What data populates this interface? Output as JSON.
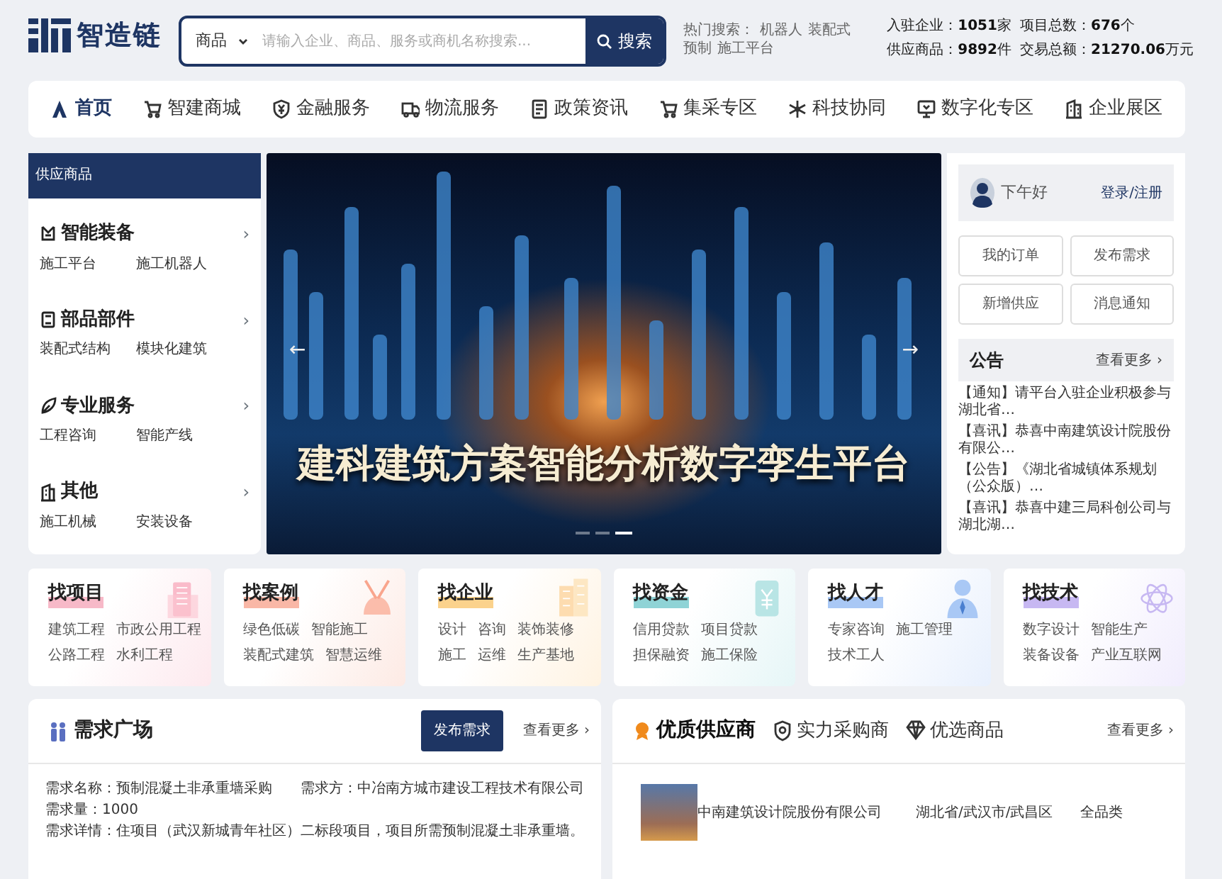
{
  "logo": {
    "text": "智造链"
  },
  "search": {
    "category": "商品",
    "placeholder": "请输入企业、商品、服务或商机名称搜索...",
    "button": "搜索"
  },
  "hot_search": {
    "label": "热门搜索：",
    "terms": [
      "机器人",
      "装配式",
      "预制",
      "施工平台"
    ]
  },
  "stats": [
    {
      "label": "入驻企业：",
      "value": "1051",
      "unit": "家"
    },
    {
      "label": "项目总数：",
      "value": "676",
      "unit": "个"
    },
    {
      "label": "供应商品：",
      "value": "9892",
      "unit": "件"
    },
    {
      "label": "交易总额：",
      "value": "21270.06",
      "unit": "万元"
    }
  ],
  "nav": [
    {
      "label": "首页",
      "selected": true
    },
    {
      "label": "智建商城",
      "selected": false
    },
    {
      "label": "金融服务",
      "selected": false
    },
    {
      "label": "物流服务",
      "selected": false
    },
    {
      "label": "政策资讯",
      "selected": false
    },
    {
      "label": "集采专区",
      "selected": false
    },
    {
      "label": "科技协同",
      "selected": false
    },
    {
      "label": "数字化专区",
      "selected": false
    },
    {
      "label": "企业展区",
      "selected": false
    }
  ],
  "sidebar": {
    "title": "供应商品",
    "categories": [
      {
        "name": "智能装备",
        "arrow": "›",
        "links": [
          "施工平台",
          "施工机器人"
        ]
      },
      {
        "name": "部品部件",
        "arrow": "›",
        "links": [
          "装配式结构",
          "模块化建筑"
        ]
      },
      {
        "name": "专业服务",
        "arrow": "›",
        "links": [
          "工程咨询",
          "智能产线"
        ]
      },
      {
        "name": "其他",
        "arrow": "›",
        "links": [
          "施工机械",
          "安装设备"
        ]
      }
    ]
  },
  "banner": {
    "title": "建科建筑方案智能分析数字孪生平台",
    "prev": "←",
    "next": "→",
    "indicators": [
      {
        "selected": false
      },
      {
        "selected": false
      },
      {
        "selected": true
      }
    ]
  },
  "user_panel": {
    "greeting": "下午好",
    "login": "登录/注册",
    "actions": [
      "我的订单",
      "发布需求",
      "新增供应",
      "消息通知"
    ],
    "notices": {
      "title": "公告",
      "more": "查看更多 ›",
      "items": [
        "【通知】请平台入驻企业积极参与湖北省…",
        "【喜讯】恭喜中南建筑设计院股份有限公…",
        "【公告】《湖北省城镇体系规划（公众版）…",
        "【喜讯】恭喜中建三局科创公司与湖北湖…"
      ]
    }
  },
  "finders": [
    {
      "title": "找项目",
      "links": [
        "建筑工程",
        "市政公用工程",
        "公路工程",
        "水利工程"
      ]
    },
    {
      "title": "找案例",
      "links": [
        "绿色低碳",
        "智能施工",
        "装配式建筑",
        "智慧运维"
      ]
    },
    {
      "title": "找企业",
      "links": [
        "设计",
        "咨询",
        "装饰装修",
        "施工",
        "运维",
        "生产基地"
      ]
    },
    {
      "title": "找资金",
      "links": [
        "信用贷款",
        "项目贷款",
        "担保融资",
        "施工保险"
      ]
    },
    {
      "title": "找人才",
      "links": [
        "专家咨询",
        "施工管理",
        "技术工人"
      ]
    },
    {
      "title": "找技术",
      "links": [
        "数字设计",
        "智能生产",
        "装备设备",
        "产业互联网"
      ]
    }
  ],
  "demand": {
    "title": "需求广场",
    "publish": "发布需求",
    "more": "查看更多 ›",
    "item": {
      "name": "需求名称：预制混凝土非承重墙采购",
      "buyer": "需求方：中冶南方城市建设工程技术有限公司",
      "quantity": "需求量：1000",
      "detail": "需求详情：住项目（武汉新城青年社区）二标段项目，项目所需预制混凝土非承重墙。"
    }
  },
  "suppliers": {
    "tabs": [
      {
        "label": "优质供应商",
        "selected": true
      },
      {
        "label": "实力采购商",
        "selected": false
      },
      {
        "label": "优选商品",
        "selected": false
      }
    ],
    "more": "查看更多 ›",
    "rows": [
      {
        "company": "中南建筑设计院股份有限公司",
        "region": "湖北省/武汉市/武昌区",
        "category": "全品类"
      }
    ]
  }
}
